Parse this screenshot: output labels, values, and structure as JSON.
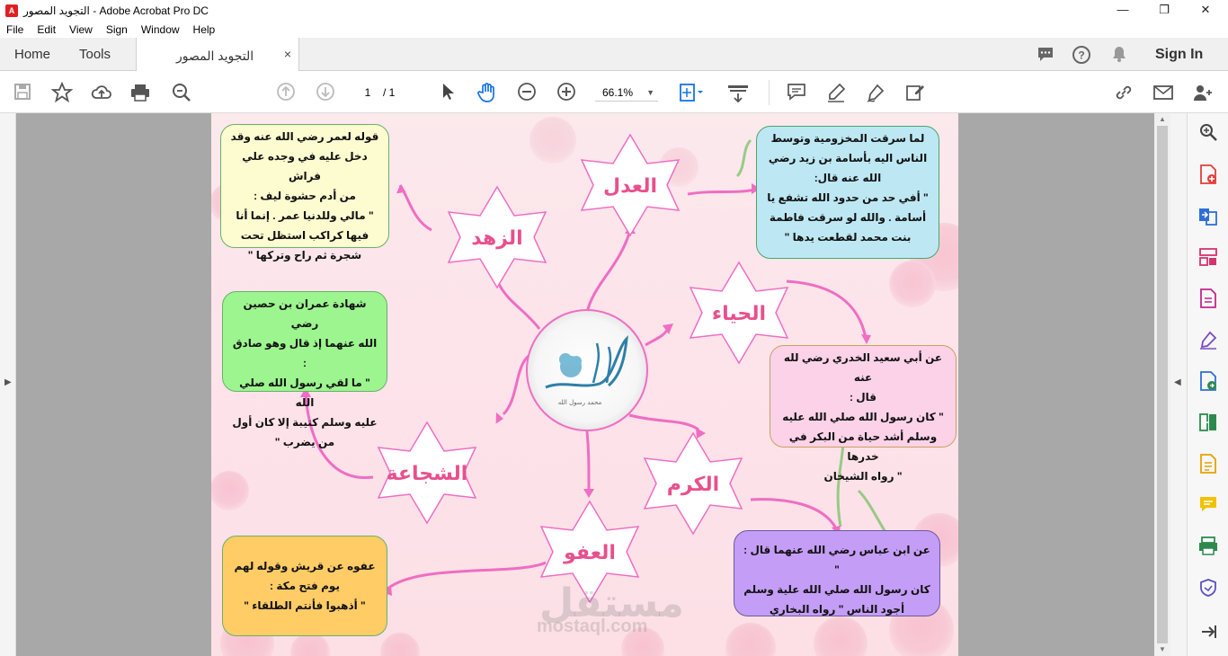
{
  "window": {
    "title": "التجويد المصور - Adobe Acrobat Pro DC",
    "min": "—",
    "restore": "❐",
    "close": "✕"
  },
  "menu": [
    "File",
    "Edit",
    "View",
    "Sign",
    "Window",
    "Help"
  ],
  "tabs": {
    "home": "Home",
    "tools": "Tools",
    "doc": "التجويد المصور",
    "close": "×"
  },
  "account": {
    "sign_in": "Sign In"
  },
  "toolbar": {
    "page_current": "1",
    "page_total": "/ 1",
    "zoom": "66.1%"
  },
  "watermark": {
    "arabic": "مستقل",
    "latin": "mostaql.com"
  },
  "mindmap": {
    "center": "محمد رسول الله",
    "stars": {
      "adl": "العدل",
      "zuhd": "الزهد",
      "haya": "الحياء",
      "shajaa": "الشجاعة",
      "karam": "الكرم",
      "afw": "العفو"
    },
    "boxes": {
      "zuhd": "قوله لعمر رضي الله عنه وقد\nدخل عليه في وجده علي فراش\nمن أدم حشوة ليف :\n\" مالي وللدنيا عمر . إنما أنا\nفيها كراكب استظل تحت\nشجرة ثم راح وتركها \"",
      "adl": "لما سرقت المخزومية وتوسط\nالناس اليه بأسامة بن زيد رضي\nالله عنه قال:\n\" أفي حد من حدود الله تشفع يا\nأسامة . والله لو سرقت فاطمة\nبنت محمد لقطعت يدها \"",
      "shajaa": "شهادة عمران بن حصين رضي\nالله عنهما إذ قال وهو صادق :\n\" ما لقي رسول الله صلي الله\nعليه وسلم كتيبة إلا كان أول\nمن يضرب \"",
      "haya": "عن أبي سعيد الخدري رضي لله عنه\nقال :\n\" كان رسول الله صلي الله عليه\nوسلم أشد حياة من البكر في خدرها\n\" رواه الشيخان",
      "karam": "عن ابن عباس رضي الله عنهما قال : \"\nكان رسول الله صلي الله علية وسلم\nأجود الناس \" رواه البخاري",
      "afw": "عفوه عن قريش وقوله لهم\nيوم فتح مكة :\n\" أذهبوا فأنتم الطلقاء \""
    }
  }
}
